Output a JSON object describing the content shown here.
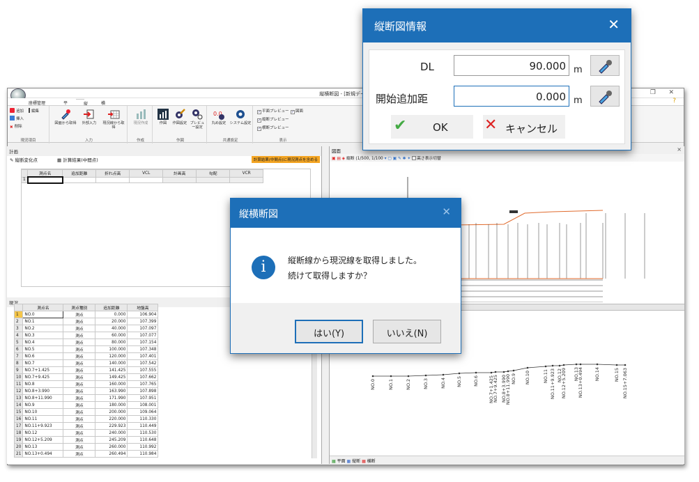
{
  "main_window": {
    "title": "縦横断図 - [新規データ]",
    "ribbon_tabs": [
      "座標管理",
      "平面",
      "縦断",
      "横断"
    ],
    "ribbon": {
      "group_input": {
        "label": "現況項目",
        "add": "追加",
        "edit": "編集",
        "insert": "挿入",
        "delete": "削除"
      },
      "group_acquire": {
        "label": "入力",
        "btn1": "図面から取得",
        "btn2": "外部入力",
        "btn3": "現況線から取得"
      },
      "group_create": {
        "label": "作成",
        "btn1": "現況作成"
      },
      "group_draw": {
        "label": "作図",
        "btn1": "作図",
        "btn2": "作図設定",
        "btn3": "プレビュー設定"
      },
      "group_common": {
        "label": "共通設定",
        "btn1": "丸め設定",
        "btn2": "システム設定"
      },
      "group_view": {
        "label": "表示",
        "opt1": "平面プレビュー",
        "opt2": "図面",
        "opt3": "縦断プレビュー",
        "opt4": "横断プレビュー"
      }
    },
    "plan_panel": {
      "title": "計画",
      "tab1": "縦断変化点",
      "tab2": "計算結果(中間点)",
      "calc_button": "計算結果(中間点)に現況測点を含める",
      "columns": [
        "測点名",
        "追加距離",
        "折れ点高",
        "VCL",
        "計画高",
        "勾配",
        "VCR"
      ],
      "first_row": "1"
    },
    "current_panel": {
      "title": "現況",
      "columns": [
        "測点名",
        "測点種別",
        "追加距離",
        "地盤高"
      ],
      "rows": [
        [
          "1",
          "NO.0",
          "測点",
          "0.000",
          "106.904"
        ],
        [
          "2",
          "NO.1",
          "測点",
          "20.000",
          "107.399"
        ],
        [
          "3",
          "NO.2",
          "測点",
          "40.000",
          "107.097"
        ],
        [
          "4",
          "NO.3",
          "測点",
          "60.000",
          "107.077"
        ],
        [
          "5",
          "NO.4",
          "測点",
          "80.000",
          "107.154"
        ],
        [
          "6",
          "NO.5",
          "測点",
          "100.000",
          "107.348"
        ],
        [
          "7",
          "NO.6",
          "測点",
          "120.000",
          "107.401"
        ],
        [
          "8",
          "NO.7",
          "測点",
          "140.000",
          "107.542"
        ],
        [
          "9",
          "NO.7+1.425",
          "測点",
          "141.425",
          "107.555"
        ],
        [
          "10",
          "NO.7+9.425",
          "測点",
          "149.425",
          "107.662"
        ],
        [
          "11",
          "NO.8",
          "測点",
          "160.000",
          "107.765"
        ],
        [
          "12",
          "NO.8+3.990",
          "測点",
          "163.990",
          "107.898"
        ],
        [
          "13",
          "NO.8+11.990",
          "測点",
          "171.990",
          "107.951"
        ],
        [
          "14",
          "NO.9",
          "測点",
          "180.000",
          "108.001"
        ],
        [
          "15",
          "NO.10",
          "測点",
          "200.000",
          "109.064"
        ],
        [
          "16",
          "NO.11",
          "測点",
          "220.000",
          "110.330"
        ],
        [
          "17",
          "NO.11+9.923",
          "測点",
          "229.923",
          "110.449"
        ],
        [
          "18",
          "NO.12",
          "測点",
          "240.000",
          "110.530"
        ],
        [
          "19",
          "NO.12+5.209",
          "測点",
          "245.209",
          "110.648"
        ],
        [
          "20",
          "NO.13",
          "測点",
          "260.000",
          "110.992"
        ],
        [
          "21",
          "NO.13+0.494",
          "測点",
          "260.494",
          "110.984"
        ]
      ]
    },
    "drawing_panel": {
      "title": "図面",
      "scale_label": "縦断 (1/500, 1/100",
      "height_toggle": "高さ表示切替",
      "bottom_tabs": [
        "平面",
        "縦断",
        "横断"
      ],
      "station_labels": [
        "NO.0",
        "NO.1",
        "NO.2",
        "NO.3",
        "NO.4",
        "NO.5",
        "NO.6",
        "NO.7+1.425",
        "NO.7+9.425",
        "NO.8+3.990",
        "NO.8+11.990",
        "NO.9",
        "NO.10",
        "NO.11",
        "NO.11+9.923",
        "NO.12",
        "NO.12+5.209",
        "NO.13",
        "NO.13+0.494",
        "NO.14",
        "NO.15",
        "NO.15+7.063"
      ]
    }
  },
  "dialog_info": {
    "title": "縦断図情報",
    "dl_label": "DL",
    "dl_value": "90.000",
    "dl_unit": "m",
    "start_label": "開始追加距",
    "start_value": "0.000",
    "start_unit": "m",
    "ok": "OK",
    "cancel": "キャンセル"
  },
  "dialog_confirm": {
    "title": "縦横断図",
    "message_line1": "縦断線から現況線を取得しました。",
    "message_line2": "続けて取得しますか？",
    "yes": "はい(Y)",
    "no": "いいえ(N)"
  },
  "colors": {
    "accent": "#1d6fb8",
    "title_bg": "#1d6fb8",
    "profile_line": "#e06a2c"
  }
}
